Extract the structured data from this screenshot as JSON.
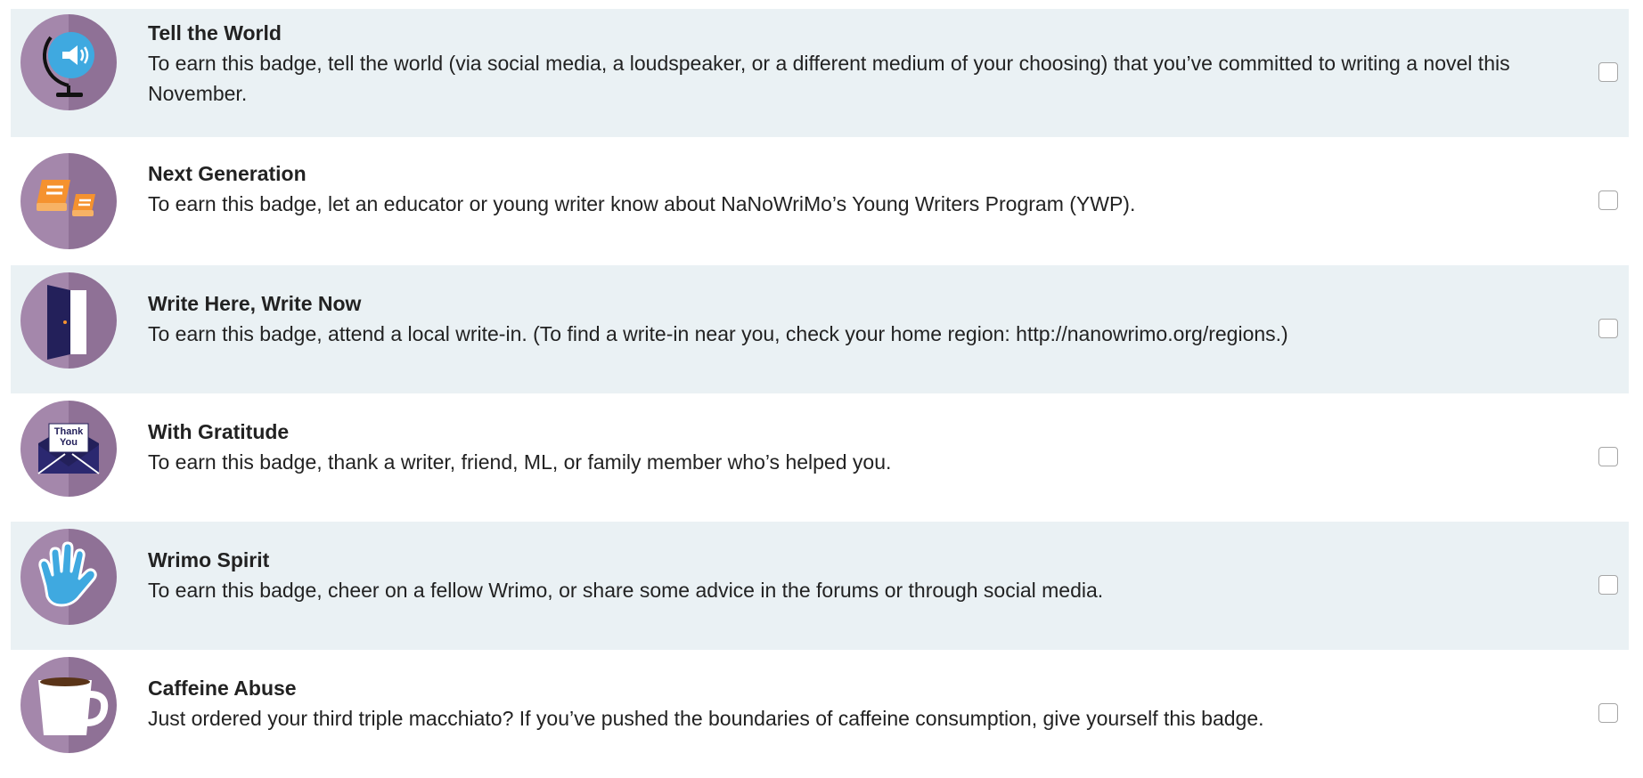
{
  "badges": [
    {
      "title": "Tell the World",
      "description": "To earn this badge, tell the world (via social media, a loudspeaker, or a different medium of your choosing) that you’ve committed to writing a novel this November.",
      "icon": "globe-megaphone-icon",
      "checked": false
    },
    {
      "title": "Next Generation",
      "description": "To earn this badge, let an educator or young writer know about NaNoWriMo’s Young Writers Program (YWP).",
      "icon": "books-icon",
      "checked": false
    },
    {
      "title": "Write Here, Write Now",
      "description": "To earn this badge, attend a local write-in. (To find a write-in near you, check your home region: http://nanowrimo.org/regions.)",
      "icon": "door-icon",
      "checked": false
    },
    {
      "title": "With Gratitude",
      "description": "To earn this badge, thank a writer, friend, ML, or family member who’s helped you.",
      "icon": "thank-you-envelope-icon",
      "icon_text": "Thank You",
      "checked": false
    },
    {
      "title": "Wrimo Spirit",
      "description": "To earn this badge, cheer on a fellow Wrimo, or share some advice in the forums or through social media.",
      "icon": "waving-hand-icon",
      "checked": false
    },
    {
      "title": "Caffeine Abuse",
      "description": "Just ordered your third triple macchiato? If you’ve pushed the boundaries of caffeine consumption, give yourself this badge.",
      "icon": "coffee-cup-icon",
      "checked": false
    }
  ],
  "colors": {
    "row_alt_bg": "#eaf1f4",
    "icon_circle": "#9b7ba3",
    "icon_circle_dark": "#8a6b93",
    "accent_blue": "#3fa9e0",
    "accent_orange": "#f5922f",
    "accent_navy": "#23205a"
  }
}
